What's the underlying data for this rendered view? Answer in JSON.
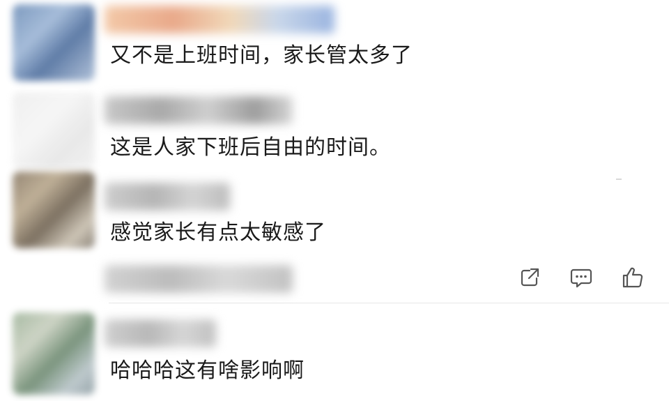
{
  "comments": [
    {
      "text": "又不是上班时间，家长管太多了"
    },
    {
      "text": "这是人家下班后自由的时间。"
    },
    {
      "text": "感觉家长有点太敏感了"
    },
    {
      "text": "哈哈哈这有啥影响啊"
    }
  ],
  "actions": {
    "share_icon": "share-icon",
    "reply_icon": "comment-icon",
    "like_icon": "thumbs-up-icon"
  },
  "colors": {
    "text": "#1a1a1a",
    "icon": "#555555",
    "divider": "#e6e6e6"
  }
}
